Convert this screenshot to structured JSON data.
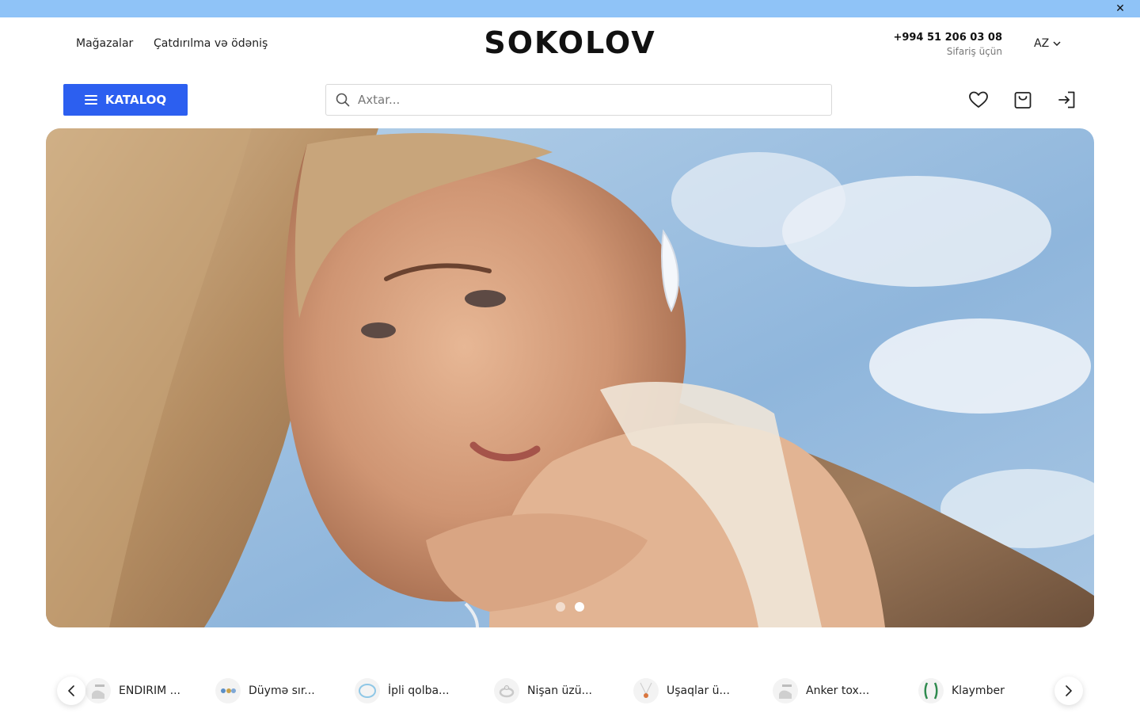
{
  "topbar": {
    "close_label": "✕"
  },
  "header": {
    "nav": [
      "Mağazalar",
      "Çatdırılma və ödəniş"
    ],
    "logo": "SOKOLOV",
    "phone": "+994 51 206 03 08",
    "phone_caption": "Sifariş üçün",
    "language": "AZ"
  },
  "toolbar": {
    "catalog_label": "KATALOQ",
    "search_placeholder": "Axtar..."
  },
  "hero": {
    "slide_count": 2,
    "active_slide": 2
  },
  "categories": [
    {
      "label": "ENDIRIM ...",
      "icon": "sale-thumb-icon"
    },
    {
      "label": "Düymə sır...",
      "icon": "button-earrings-thumb-icon"
    },
    {
      "label": "İpli qolba...",
      "icon": "string-bracelet-thumb-icon"
    },
    {
      "label": "Nişan üzü...",
      "icon": "engagement-ring-thumb-icon"
    },
    {
      "label": "Uşaqlar ü...",
      "icon": "kids-pendant-thumb-icon"
    },
    {
      "label": "Anker tox...",
      "icon": "anchor-chain-thumb-icon"
    },
    {
      "label": "Klaymber",
      "icon": "climber-earring-thumb-icon"
    }
  ],
  "colors": {
    "accent": "#2c5ff0",
    "topbar": "#8fc3f7"
  }
}
